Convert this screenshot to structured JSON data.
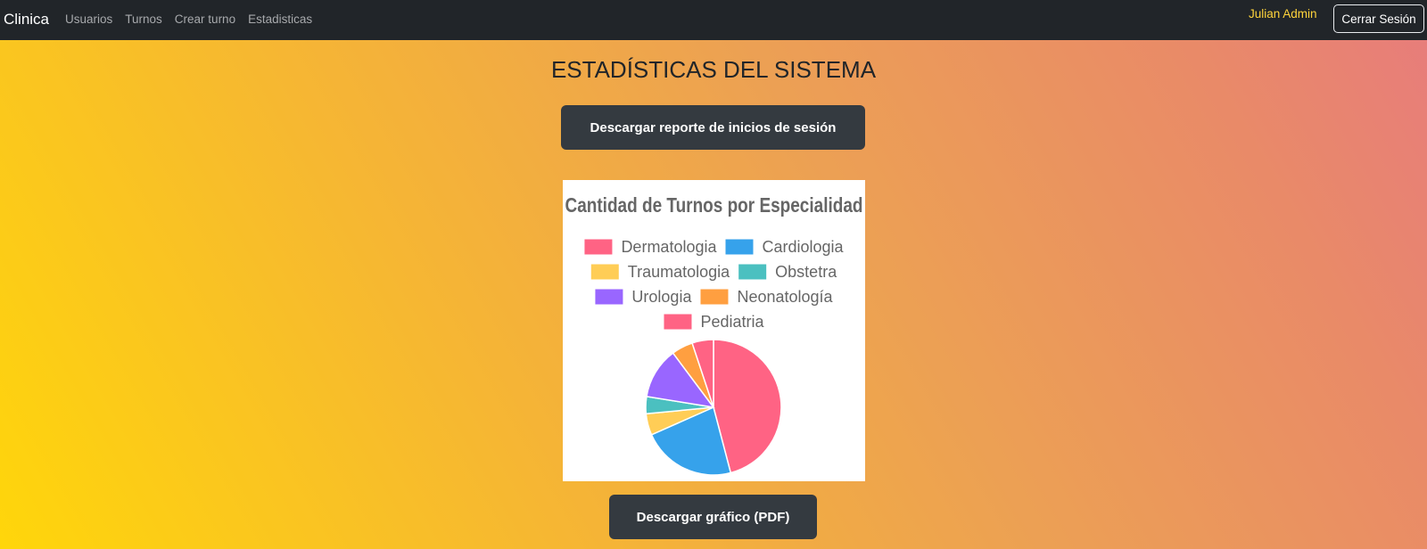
{
  "navbar": {
    "brand": "Clinica",
    "links": [
      {
        "label": "Usuarios"
      },
      {
        "label": "Turnos"
      },
      {
        "label": "Crear turno"
      },
      {
        "label": "Estadisticas"
      }
    ],
    "user_name": "Julian Admin",
    "logout_label": "Cerrar Sesión"
  },
  "main": {
    "title": "ESTADÍSTICAS DEL SISTEMA",
    "report_button_label": "Descargar reporte de inicios de sesión",
    "pdf_button_label": "Descargar gráfico (PDF)"
  },
  "chart_data": {
    "type": "pie",
    "title": "Cantidad de Turnos por Especialidad",
    "legend_position": "top",
    "categories": [
      "Dermatologia",
      "Cardiologia",
      "Traumatologia",
      "Obstetra",
      "Urologia",
      "Neonatología",
      "Pediatria"
    ],
    "values": [
      45,
      22,
      5,
      4,
      12,
      5,
      5
    ],
    "colors": [
      "#ff6384",
      "#36a2eb",
      "#ffcd56",
      "#4bc0c0",
      "#9966ff",
      "#ff9f40",
      "#ff6384"
    ]
  }
}
